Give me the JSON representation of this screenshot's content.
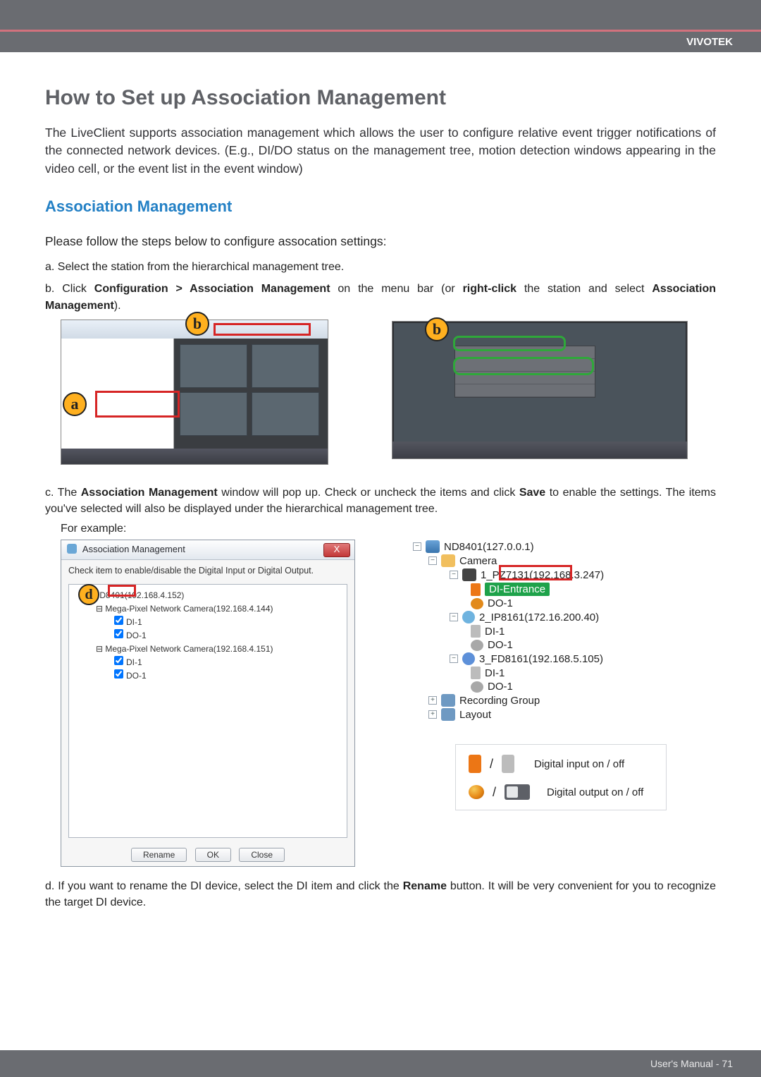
{
  "header": {
    "brand": "VIVOTEK"
  },
  "title": "How to Set up Association Management",
  "intro": "The LiveClient supports association management which allows the user to configure relative event trigger notifications of the connected network devices. (E.g., DI/DO status on the management tree, motion detection windows appearing in the video cell, or the event list in the event window)",
  "section_heading": "Association Management",
  "subintro": "Please follow the steps below to configure assocation settings:",
  "steps": {
    "a": "a. Select the station from the hierarchical management tree.",
    "b_pre": "b. Click ",
    "b_bold1": "Configuration > Association Management",
    "b_mid": " on the menu bar (or ",
    "b_bold2": "right-click",
    "b_post": " the station and select ",
    "b_bold3": "Association Management",
    "b_end": ").",
    "c_pre": "c. The ",
    "c_bold1": "Association Management",
    "c_mid": " window will pop up. Check or uncheck the items and click ",
    "c_bold2": "Save",
    "c_post": " to enable the settings. The items you've selected will also be displayed under the hierarchical management tree.",
    "d_pre": "d. If you want to rename the DI device, select the DI item and click the ",
    "d_bold": "Rename",
    "d_post": " button. It will be very convenient for you to recognize the target DI device."
  },
  "example_label": "For example:",
  "markers": {
    "a": "a",
    "b": "b",
    "d": "d"
  },
  "dialog": {
    "title": "Association Management",
    "close_x": "X",
    "info": "Check item to enable/disable the Digital Input or Digital Output.",
    "station": "ND8401(192.168.4.152)",
    "cam1": "Mega-Pixel Network Camera(192.168.4.144)",
    "di1": "DI-1",
    "do1": "DO-1",
    "cam2": "Mega-Pixel Network Camera(192.168.4.151)",
    "di1b": "DI-1",
    "do1b": "DO-1",
    "buttons": {
      "rename": "Rename",
      "ok": "OK",
      "close": "Close"
    }
  },
  "tree": {
    "station": "ND8401(127.0.0.1)",
    "camera": "Camera",
    "c1": "1_PZ7131(192.168.3.247)",
    "c1_di": "DI-Entrance",
    "c1_do": "DO-1",
    "c2": "2_IP8161(172.16.200.40)",
    "c2_di": "DI-1",
    "c2_do": "DO-1",
    "c3": "3_FD8161(192.168.5.105)",
    "c3_di": "DI-1",
    "c3_do": "DO-1",
    "recgrp": "Recording Group",
    "layout": "Layout"
  },
  "legend": {
    "di": "Digital input on / off",
    "do": "Digital output on / off"
  },
  "footer": "User's Manual - 71"
}
